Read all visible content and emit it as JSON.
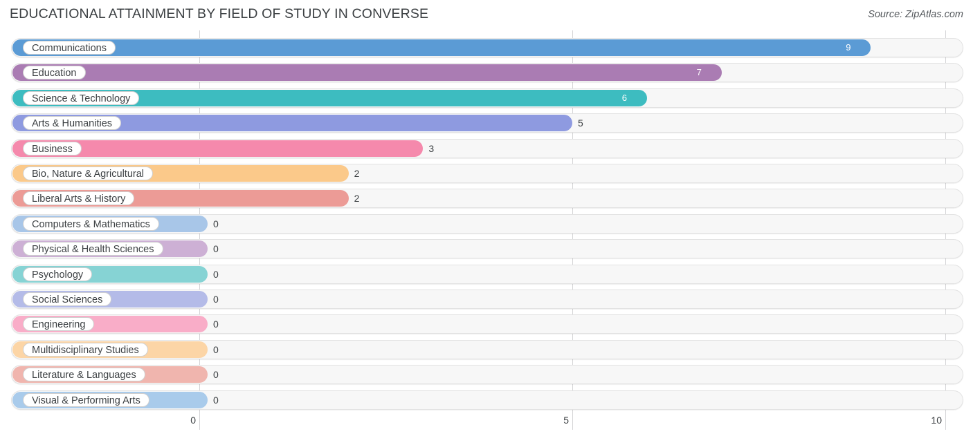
{
  "header": {
    "title": "EDUCATIONAL ATTAINMENT BY FIELD OF STUDY IN CONVERSE",
    "source": "Source: ZipAtlas.com"
  },
  "axis": {
    "ticks": [
      "0",
      "5",
      "10"
    ],
    "min": 0,
    "max": 10
  },
  "chart_data": {
    "type": "bar",
    "orientation": "horizontal",
    "title": "EDUCATIONAL ATTAINMENT BY FIELD OF STUDY IN CONVERSE",
    "subtitle": "Source: ZipAtlas.com",
    "xlabel": "",
    "ylabel": "",
    "xlim": [
      0,
      10
    ],
    "xticks": [
      0,
      5,
      10
    ],
    "grid": true,
    "legend": false,
    "categories": [
      "Communications",
      "Education",
      "Science & Technology",
      "Arts & Humanities",
      "Business",
      "Bio, Nature & Agricultural",
      "Liberal Arts & History",
      "Computers & Mathematics",
      "Physical & Health Sciences",
      "Psychology",
      "Social Sciences",
      "Engineering",
      "Multidisciplinary Studies",
      "Literature & Languages",
      "Visual & Performing Arts"
    ],
    "values": [
      9,
      7,
      6,
      5,
      3,
      2,
      2,
      0,
      0,
      0,
      0,
      0,
      0,
      0,
      0
    ],
    "colors": [
      "#5b9bd5",
      "#aa7cb3",
      "#3dbcc0",
      "#8e9ae0",
      "#f589ac",
      "#fbc98a",
      "#ec9b96",
      "#a8c6e8",
      "#cdb0d5",
      "#86d3d4",
      "#b4bbe8",
      "#f9adc8",
      "#fcd5a6",
      "#f0b5ae",
      "#a9cbeb"
    ]
  },
  "rows": [
    {
      "label": "Communications",
      "value": "9",
      "color": "#5b9bd5",
      "inside": true
    },
    {
      "label": "Education",
      "value": "7",
      "color": "#aa7cb3",
      "inside": true
    },
    {
      "label": "Science & Technology",
      "value": "6",
      "color": "#3dbcc0",
      "inside": true
    },
    {
      "label": "Arts & Humanities",
      "value": "5",
      "color": "#8e9ae0",
      "inside": false
    },
    {
      "label": "Business",
      "value": "3",
      "color": "#f589ac",
      "inside": false
    },
    {
      "label": "Bio, Nature & Agricultural",
      "value": "2",
      "color": "#fbc98a",
      "inside": false
    },
    {
      "label": "Liberal Arts & History",
      "value": "2",
      "color": "#ec9b96",
      "inside": false
    },
    {
      "label": "Computers & Mathematics",
      "value": "0",
      "color": "#a8c6e8",
      "inside": false
    },
    {
      "label": "Physical & Health Sciences",
      "value": "0",
      "color": "#cdb0d5",
      "inside": false
    },
    {
      "label": "Psychology",
      "value": "0",
      "color": "#86d3d4",
      "inside": false
    },
    {
      "label": "Social Sciences",
      "value": "0",
      "color": "#b4bbe8",
      "inside": false
    },
    {
      "label": "Engineering",
      "value": "0",
      "color": "#f9adc8",
      "inside": false
    },
    {
      "label": "Multidisciplinary Studies",
      "value": "0",
      "color": "#fcd5a6",
      "inside": false
    },
    {
      "label": "Literature & Languages",
      "value": "0",
      "color": "#f0b5ae",
      "inside": false
    },
    {
      "label": "Visual & Performing Arts",
      "value": "0",
      "color": "#a9cbeb",
      "inside": false
    }
  ]
}
